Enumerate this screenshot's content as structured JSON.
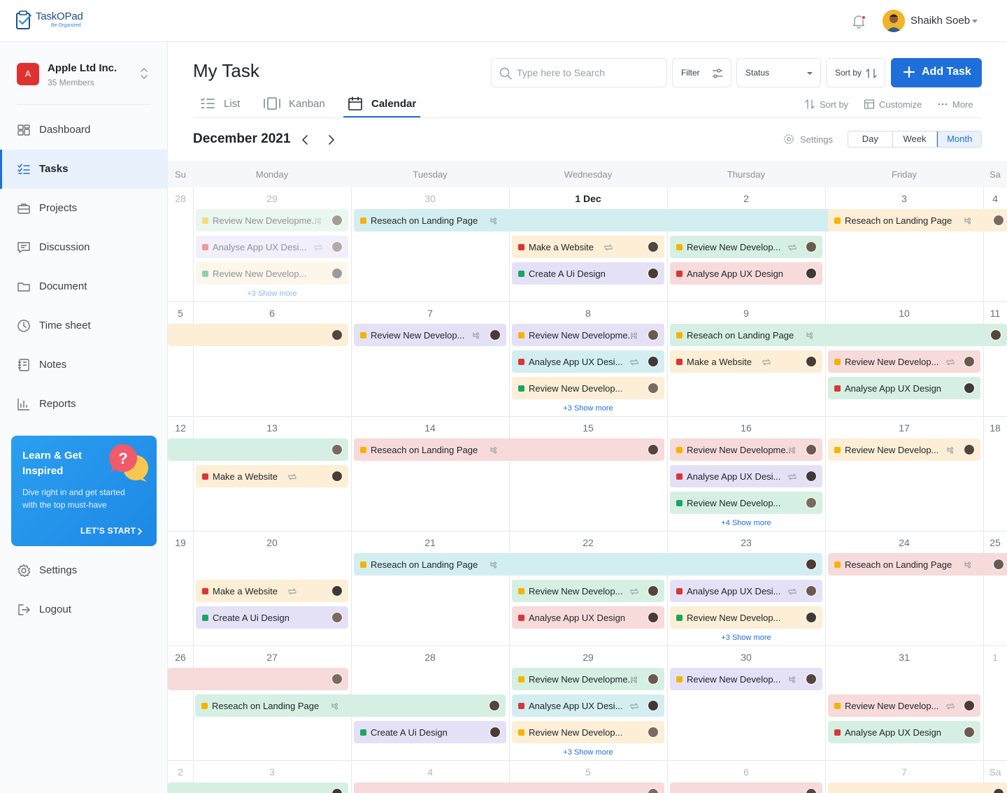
{
  "app": {
    "logo_name": "TaskOPad",
    "logo_tagline": "Be Organized"
  },
  "user": {
    "name": "Shaikh Soeb"
  },
  "org": {
    "badge": "A",
    "name": "Apple Ltd Inc.",
    "members": "35 Members"
  },
  "nav": [
    {
      "label": "Dashboard",
      "icon": "dashboard-icon"
    },
    {
      "label": "Tasks",
      "icon": "tasks-icon",
      "active": true
    },
    {
      "label": "Projects",
      "icon": "projects-icon"
    },
    {
      "label": "Discussion",
      "icon": "discussion-icon"
    },
    {
      "label": "Document",
      "icon": "folder-icon"
    },
    {
      "label": "Time sheet",
      "icon": "clock-icon"
    },
    {
      "label": "Notes",
      "icon": "notes-icon"
    },
    {
      "label": "Reports",
      "icon": "reports-icon"
    }
  ],
  "nav_bottom": [
    {
      "label": "Settings",
      "icon": "gear-icon"
    },
    {
      "label": "Logout",
      "icon": "logout-icon"
    }
  ],
  "promo": {
    "title": "Learn & Get Inspired",
    "text": "Dive right in and get started with the top must-have",
    "cta": "LET'S START"
  },
  "page": {
    "title": "My Task",
    "search_placeholder": "Type here to Search",
    "filter_label": "Filter",
    "status_label": "Status",
    "sortby_label": "Sort by",
    "add_label": "Add Task"
  },
  "view_tabs": [
    {
      "label": "List",
      "icon": "list-icon"
    },
    {
      "label": "Kanban",
      "icon": "kanban-icon"
    },
    {
      "label": "Calendar",
      "icon": "calendar-icon",
      "active": true
    }
  ],
  "tools": [
    {
      "label": "Sort by",
      "icon": "sort-icon"
    },
    {
      "label": "Customize",
      "icon": "table-icon"
    },
    {
      "label": "More",
      "icon": "more-icon"
    }
  ],
  "calendar": {
    "month": "December 2021",
    "settings_label": "Settings",
    "views": [
      "Day",
      "Week",
      "Month"
    ],
    "active_view": "Month",
    "weekdays": [
      "Su",
      "Monday",
      "Tuesday",
      "Wednesday",
      "Thursday",
      "Friday",
      "Sa"
    ],
    "weeks": [
      [
        "28",
        "29",
        "30",
        "1 Dec",
        "2",
        "3",
        "4"
      ],
      [
        "5",
        "6",
        "7",
        "8",
        "9",
        "10",
        "11"
      ],
      [
        "12",
        "13",
        "14",
        "15",
        "16",
        "17",
        "18"
      ],
      [
        "19",
        "20",
        "21",
        "22",
        "23",
        "24",
        "25"
      ],
      [
        "26",
        "27",
        "28",
        "29",
        "30",
        "31",
        "1"
      ],
      [
        "2",
        "3",
        "4",
        "5",
        "6",
        "7",
        "Sa"
      ]
    ],
    "show_more": [
      "+3 Show more",
      "+3 Show more",
      "+4 Show more",
      "+3 Show more",
      "+3 Show more"
    ],
    "colors": {
      "blue_bg": "#d2eef0",
      "peach_bg": "#fcefd6",
      "purple_bg": "#e4e1f7",
      "green_bg": "#d5f0e3",
      "pink_bg": "#f7dada",
      "yellow_dot": "#f4b400",
      "red_dot": "#d93636",
      "green_dot": "#1ea362"
    },
    "events": [
      {
        "label": "Review New Developme..",
        "sub": "subtask-icon"
      },
      {
        "label": "Analyse App UX Desi...",
        "sub": "repeat-icon"
      },
      {
        "label": "Review New Develop..."
      },
      {
        "label": "Reseach on Landing Page",
        "sub": "subtask-icon"
      },
      {
        "label": "Make a Website",
        "sub": "repeat-icon"
      },
      {
        "label": "Create A Ui Design"
      },
      {
        "label": "Review New Develop...",
        "sub": "repeat-icon"
      },
      {
        "label": "Analyse App UX Design"
      },
      {
        "label": "Reseach on Landing Page",
        "sub": "subtask-icon"
      },
      {
        "label": "Review New Develop...",
        "sub": "subtask-icon"
      },
      {
        "label": "Review New Developme..",
        "sub": "subtask-icon"
      },
      {
        "label": "Analyse App UX Desi...",
        "sub": "repeat-icon"
      },
      {
        "label": "Review New Develop..."
      },
      {
        "label": "Reseach on Landing Page",
        "sub": "subtask-icon"
      },
      {
        "label": "Make a Website",
        "sub": "repeat-icon"
      },
      {
        "label": "Review New Develop...",
        "sub": "repeat-icon"
      },
      {
        "label": "Analyse App UX Design"
      },
      {
        "label": "Reseach on Landing Page",
        "sub": "subtask-icon"
      },
      {
        "label": "Make a Website",
        "sub": "repeat-icon"
      },
      {
        "label": "Review New Developme..",
        "sub": "subtask-icon"
      },
      {
        "label": "Analyse App UX Desi...",
        "sub": "repeat-icon"
      },
      {
        "label": "Review New Develop..."
      },
      {
        "label": "Review New Develop...",
        "sub": "subtask-icon"
      },
      {
        "label": "Reseach on Landing Page",
        "sub": "subtask-icon"
      },
      {
        "label": "Reseach on Landing Page",
        "sub": "subtask-icon"
      },
      {
        "label": "Make a Website",
        "sub": "repeat-icon"
      },
      {
        "label": "Create A Ui Design"
      },
      {
        "label": "Review New Develop...",
        "sub": "repeat-icon"
      },
      {
        "label": "Analyse App UX Design"
      },
      {
        "label": "Analyse App UX Desi...",
        "sub": "repeat-icon"
      },
      {
        "label": "Review New Develop..."
      },
      {
        "label": "Reseach on Landing Page",
        "sub": "subtask-icon"
      },
      {
        "label": "Create A Ui Design"
      },
      {
        "label": "Review New Developme..",
        "sub": "subtask-icon"
      },
      {
        "label": "Analyse App UX Desi...",
        "sub": "repeat-icon"
      },
      {
        "label": "Review New Develop..."
      },
      {
        "label": "Review New Develop...",
        "sub": "subtask-icon"
      },
      {
        "label": "Review New Develop...",
        "sub": "repeat-icon"
      },
      {
        "label": "Analyse App UX Design"
      }
    ]
  }
}
